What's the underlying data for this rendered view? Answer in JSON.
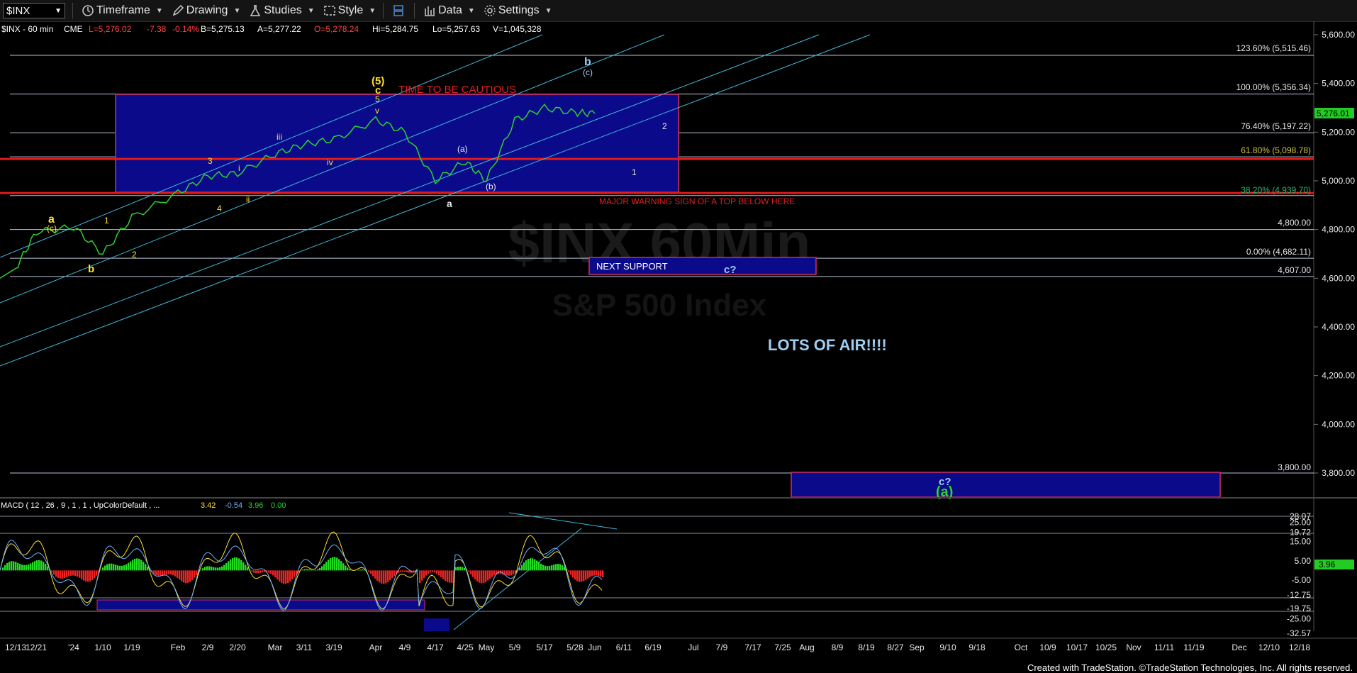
{
  "toolbar": {
    "symbol": "$INX",
    "timeframe": "Timeframe",
    "drawing": "Drawing",
    "studies": "Studies",
    "style": "Style",
    "data": "Data",
    "settings": "Settings"
  },
  "header": {
    "symbol": "$INX - 60 min",
    "exchange": "CME",
    "last": "L=5,276.02",
    "change": "-7.38",
    "change_pct": "-0.14%",
    "bid": "B=5,275.13",
    "ask": "A=5,277.22",
    "open": "O=5,278.24",
    "high": "Hi=5,284.75",
    "low": "Lo=5,257.63",
    "volume": "V=1,045,328"
  },
  "watermark": {
    "line1": "$INX 60Min",
    "line2": "S&P 500 Index"
  },
  "macd_header": {
    "label": "MACD ( 12 , 26 , 9 , 1 , 1 , UpColorDefault , ...",
    "v1": "3.42",
    "v2": "-0.54",
    "v3": "3.96",
    "v4": "0.00"
  },
  "annotations": {
    "caution": "TIME TO BE CAUTIOUS",
    "warning": "MAJOR WARNING SIGN OF A TOP BELOW HERE",
    "support": "NEXT SUPPORT",
    "air": "LOTS OF AIR!!!!",
    "c_q1": "c?",
    "c_q2": "c?",
    "a_paren": "(a)"
  },
  "wave_labels": {
    "a_y": "a",
    "c_y": "(c)",
    "b_y": "b",
    "one": "1",
    "two": "2",
    "three": "3",
    "four": "4",
    "i": "i",
    "ii": "ii",
    "iii": "iii",
    "iv": "iv",
    "v": "v",
    "five": "5",
    "c_top": "c",
    "five_paren": "(5)",
    "a_w": "a",
    "a_paren": "(a)",
    "b_paren": "(b)",
    "b_w": "b",
    "c_paren": "(c)",
    "one_w": "1",
    "two_w": "2"
  },
  "fib_labels": {
    "f1236": "123.60% (5,515.46)",
    "f100": "100.00% (5,356.34)",
    "f764": "76.40% (5,197.22)",
    "f618": "61.80% (5,098.78)",
    "f382": "38.20% (4,939.70)",
    "f0": "0.00% (4,682.11)",
    "l4800": "4,800.00",
    "l4607": "4,607.00",
    "l3800": "3,800.00"
  },
  "price_axis": [
    "5,600.00",
    "5,400.00",
    "5,200.00",
    "5,000.00",
    "4,800.00",
    "4,600.00",
    "4,400.00",
    "4,200.00",
    "4,000.00",
    "3,800.00"
  ],
  "current_price": "5,276.01",
  "macd_axis": [
    "28.07",
    "25.00",
    "19.72",
    "15.00",
    "5.00",
    "-5.00",
    "-12.75",
    "-19.75",
    "-25.00",
    "-32.57"
  ],
  "macd_current": "3.96",
  "x_axis": [
    "12/13",
    "12/21",
    "'24",
    "1/10",
    "1/19",
    "Feb",
    "2/9",
    "2/20",
    "Mar",
    "3/11",
    "3/19",
    "Apr",
    "4/9",
    "4/17",
    "4/25",
    "May",
    "5/9",
    "5/17",
    "5/28",
    "Jun",
    "6/11",
    "6/19",
    "Jul",
    "7/9",
    "7/17",
    "7/25",
    "Aug",
    "8/9",
    "8/19",
    "8/27",
    "Sep",
    "9/10",
    "9/18",
    "Oct",
    "10/9",
    "10/17",
    "10/25",
    "Nov",
    "11/11",
    "11/19",
    "Dec",
    "12/10",
    "12/18"
  ],
  "footer": "Created with TradeStation. ©TradeStation Technologies, Inc. All rights reserved.",
  "chart_data": {
    "type": "line",
    "title": "$INX - 60 min",
    "ylim": [
      3700,
      5650
    ],
    "y_ticks": [
      5600,
      5400,
      5200,
      5000,
      4800,
      4600,
      4400,
      4200,
      4000,
      3800
    ],
    "x_categories": [
      "12/13",
      "12/21",
      "'24",
      "1/10",
      "1/19",
      "Feb",
      "2/9",
      "2/20",
      "Mar",
      "3/11",
      "3/19",
      "Apr",
      "4/9",
      "4/17",
      "4/25",
      "May",
      "5/9",
      "5/17",
      "5/28",
      "Jun",
      "6/11",
      "6/19",
      "Jul",
      "7/9",
      "7/17",
      "7/25",
      "Aug",
      "8/9",
      "8/19",
      "8/27",
      "Sep",
      "9/10",
      "9/18",
      "Oct",
      "10/9",
      "10/17",
      "10/25",
      "Nov",
      "11/11",
      "11/19",
      "Dec",
      "12/10",
      "12/18"
    ],
    "series": [
      {
        "points": [
          [
            "12/13",
            4640
          ],
          [
            "12/21",
            4790
          ],
          [
            "'24",
            4810
          ],
          [
            "1/10",
            4700
          ],
          [
            "1/19",
            4850
          ],
          [
            "Feb",
            4950
          ],
          [
            "2/9",
            5020
          ],
          [
            "2/20",
            5030
          ],
          [
            "Mar",
            5110
          ],
          [
            "3/11",
            5150
          ],
          [
            "3/19",
            5170
          ],
          [
            "Apr",
            5250
          ],
          [
            "4/9",
            5200
          ],
          [
            "4/17",
            5000
          ],
          [
            "4/25",
            5080
          ],
          [
            "May",
            5000
          ],
          [
            "5/9",
            5250
          ],
          [
            "5/17",
            5300
          ],
          [
            "5/28",
            5280
          ],
          [
            "Jun",
            5276
          ]
        ]
      }
    ],
    "fib_levels": [
      {
        "label": "123.60%",
        "value": 5515.46
      },
      {
        "label": "100.00%",
        "value": 5356.34
      },
      {
        "label": "76.40%",
        "value": 5197.22
      },
      {
        "label": "61.80%",
        "value": 5098.78
      },
      {
        "label": "38.20%",
        "value": 4939.7
      },
      {
        "label": "0.00%",
        "value": 4682.11
      }
    ],
    "horizontal_levels": [
      4800,
      4607,
      3800
    ],
    "red_levels": [
      5090,
      4950
    ],
    "last_price": 5276.01,
    "macd": {
      "ylim": [
        -32.57,
        28.07
      ],
      "ticks": [
        28.07,
        25,
        19.72,
        15,
        5,
        -5,
        -12.75,
        -19.75,
        -25,
        -32.57
      ],
      "values": [
        3.42,
        -0.54,
        3.96,
        0.0
      ]
    }
  }
}
